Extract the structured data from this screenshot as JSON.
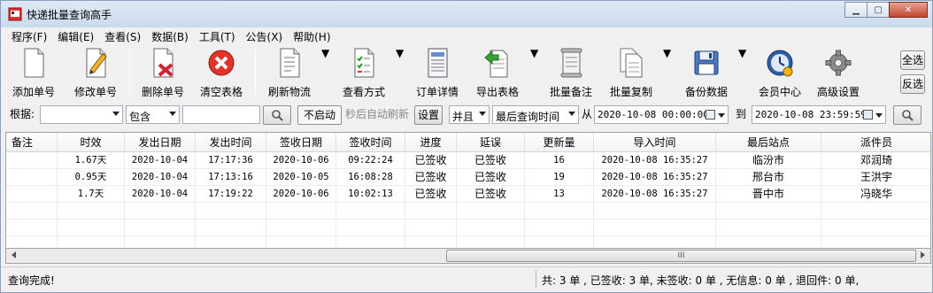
{
  "window": {
    "title": "快递批量查询高手",
    "minimize_glyph": "▁",
    "maximize_glyph": "▢",
    "close_glyph": "✕"
  },
  "menu": [
    "程序(F)",
    "编辑(E)",
    "查看(S)",
    "数据(B)",
    "工具(T)",
    "公告(X)",
    "帮助(H)"
  ],
  "toolbar": {
    "add": "添加单号",
    "edit": "修改单号",
    "delete": "删除单号",
    "clear": "清空表格",
    "refresh": "刷新物流",
    "view_mode": "查看方式",
    "order_detail": "订单详情",
    "export": "导出表格",
    "batch_note": "批量备注",
    "batch_copy": "批量复制",
    "backup": "备份数据",
    "member": "会员中心",
    "advanced": "高级设置",
    "select_all": "全选",
    "invert": "反选",
    "dropdown_glyph": "▼"
  },
  "search": {
    "by_label": "根据:",
    "field_value": "",
    "match_value": "包含",
    "keyword_value": "",
    "search_icon": "search-icon",
    "auto_refresh_state": "不启动",
    "auto_refresh_text": "秒后自动刷新",
    "settings_label": "设置",
    "logic_value": "并且",
    "time_field_value": "最后查询时间",
    "from_label": "从",
    "from_value": "2020-10-08 00:00:00",
    "to_label": "到",
    "to_value": "2020-10-08 23:59:59"
  },
  "table": {
    "columns": [
      "备注",
      "时效",
      "发出日期",
      "发出时间",
      "签收日期",
      "签收时间",
      "进度",
      "延误",
      "更新量",
      "导入时间",
      "最后站点",
      "派件员"
    ],
    "rows": [
      [
        "",
        "1.67天",
        "2020-10-04",
        "17:17:36",
        "2020-10-06",
        "09:22:24",
        "已签收",
        "已签收",
        "16",
        "2020-10-08 16:35:27",
        "临汾市",
        "邓润琦"
      ],
      [
        "",
        "0.95天",
        "2020-10-04",
        "17:13:16",
        "2020-10-05",
        "16:08:28",
        "已签收",
        "已签收",
        "19",
        "2020-10-08 16:35:27",
        "邢台市",
        "王洪宇"
      ],
      [
        "",
        "1.7天",
        "2020-10-04",
        "17:19:22",
        "2020-10-06",
        "10:02:13",
        "已签收",
        "已签收",
        "13",
        "2020-10-08 16:35:27",
        "晋中市",
        "冯晓华"
      ]
    ]
  },
  "scrollbar": {
    "thumb_grip": "III"
  },
  "status": {
    "left": "查询完成!",
    "right": "共: 3 单 , 已签收: 3 单, 未签收: 0 单 , 无信息: 0 单 , 退回件: 0 单,"
  }
}
